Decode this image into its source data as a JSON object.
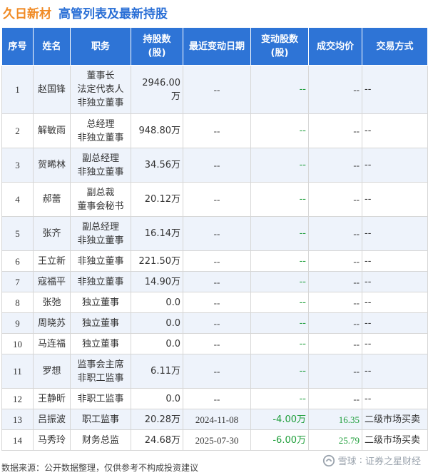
{
  "header": {
    "company": "久日新材",
    "title": "高管列表及最新持股"
  },
  "columns": [
    "序号",
    "姓名",
    "职务",
    "持股数\n(股)",
    "最近变动日期",
    "变动股数\n(股)",
    "成交均价",
    "交易方式"
  ],
  "rows": [
    {
      "no": "1",
      "name": "赵国锋",
      "position": [
        "董事长",
        "法定代表人",
        "非独立董事"
      ],
      "shares": "2946.00万",
      "date": "--",
      "change": "--",
      "price": "--",
      "method": "--"
    },
    {
      "no": "2",
      "name": "解敏雨",
      "position": [
        "总经理",
        "非独立董事"
      ],
      "shares": "948.80万",
      "date": "--",
      "change": "--",
      "price": "--",
      "method": "--"
    },
    {
      "no": "3",
      "name": "贺晞林",
      "position": [
        "副总经理",
        "非独立董事"
      ],
      "shares": "34.56万",
      "date": "--",
      "change": "--",
      "price": "--",
      "method": "--"
    },
    {
      "no": "4",
      "name": "郝蕾",
      "position": [
        "副总裁",
        "董事会秘书"
      ],
      "shares": "20.12万",
      "date": "--",
      "change": "--",
      "price": "--",
      "method": "--"
    },
    {
      "no": "5",
      "name": "张齐",
      "position": [
        "副总经理",
        "非独立董事"
      ],
      "shares": "16.14万",
      "date": "--",
      "change": "--",
      "price": "--",
      "method": "--"
    },
    {
      "no": "6",
      "name": "王立新",
      "position": [
        "非独立董事"
      ],
      "shares": "221.50万",
      "date": "--",
      "change": "--",
      "price": "--",
      "method": "--"
    },
    {
      "no": "7",
      "name": "寇福平",
      "position": [
        "非独立董事"
      ],
      "shares": "14.90万",
      "date": "--",
      "change": "--",
      "price": "--",
      "method": "--"
    },
    {
      "no": "8",
      "name": "张弛",
      "position": [
        "独立董事"
      ],
      "shares": "0.0",
      "date": "--",
      "change": "--",
      "price": "--",
      "method": "--"
    },
    {
      "no": "9",
      "name": "周晓苏",
      "position": [
        "独立董事"
      ],
      "shares": "0.0",
      "date": "--",
      "change": "--",
      "price": "--",
      "method": "--"
    },
    {
      "no": "10",
      "name": "马连福",
      "position": [
        "独立董事"
      ],
      "shares": "0.0",
      "date": "--",
      "change": "--",
      "price": "--",
      "method": "--"
    },
    {
      "no": "11",
      "name": "罗想",
      "position": [
        "监事会主席",
        "非职工监事"
      ],
      "shares": "6.11万",
      "date": "--",
      "change": "--",
      "price": "--",
      "method": "--"
    },
    {
      "no": "12",
      "name": "王静昕",
      "position": [
        "非职工监事"
      ],
      "shares": "0.0",
      "date": "--",
      "change": "--",
      "price": "--",
      "method": "--"
    },
    {
      "no": "13",
      "name": "吕振波",
      "position": [
        "职工监事"
      ],
      "shares": "20.28万",
      "date": "2024-11-08",
      "change": "-4.00万",
      "price": "16.35",
      "method": "二级市场买卖"
    },
    {
      "no": "14",
      "name": "马秀玲",
      "position": [
        "财务总监"
      ],
      "shares": "24.68万",
      "date": "2025-07-30",
      "change": "-6.00万",
      "price": "25.79",
      "method": "二级市场买卖"
    }
  ],
  "colors": {
    "header_bg": "#2e74d6",
    "stripe": "#eef3fb",
    "company": "#f08a24",
    "title": "#2a6fd6",
    "negative": "#1e9e3a"
  },
  "footer": {
    "source": "数据来源：公开数据整理，仅供参考不构成投资建议"
  },
  "brand": {
    "name1": "雪球",
    "sep": ":",
    "name2": "证券之星财经"
  },
  "watermark": "证券之星"
}
